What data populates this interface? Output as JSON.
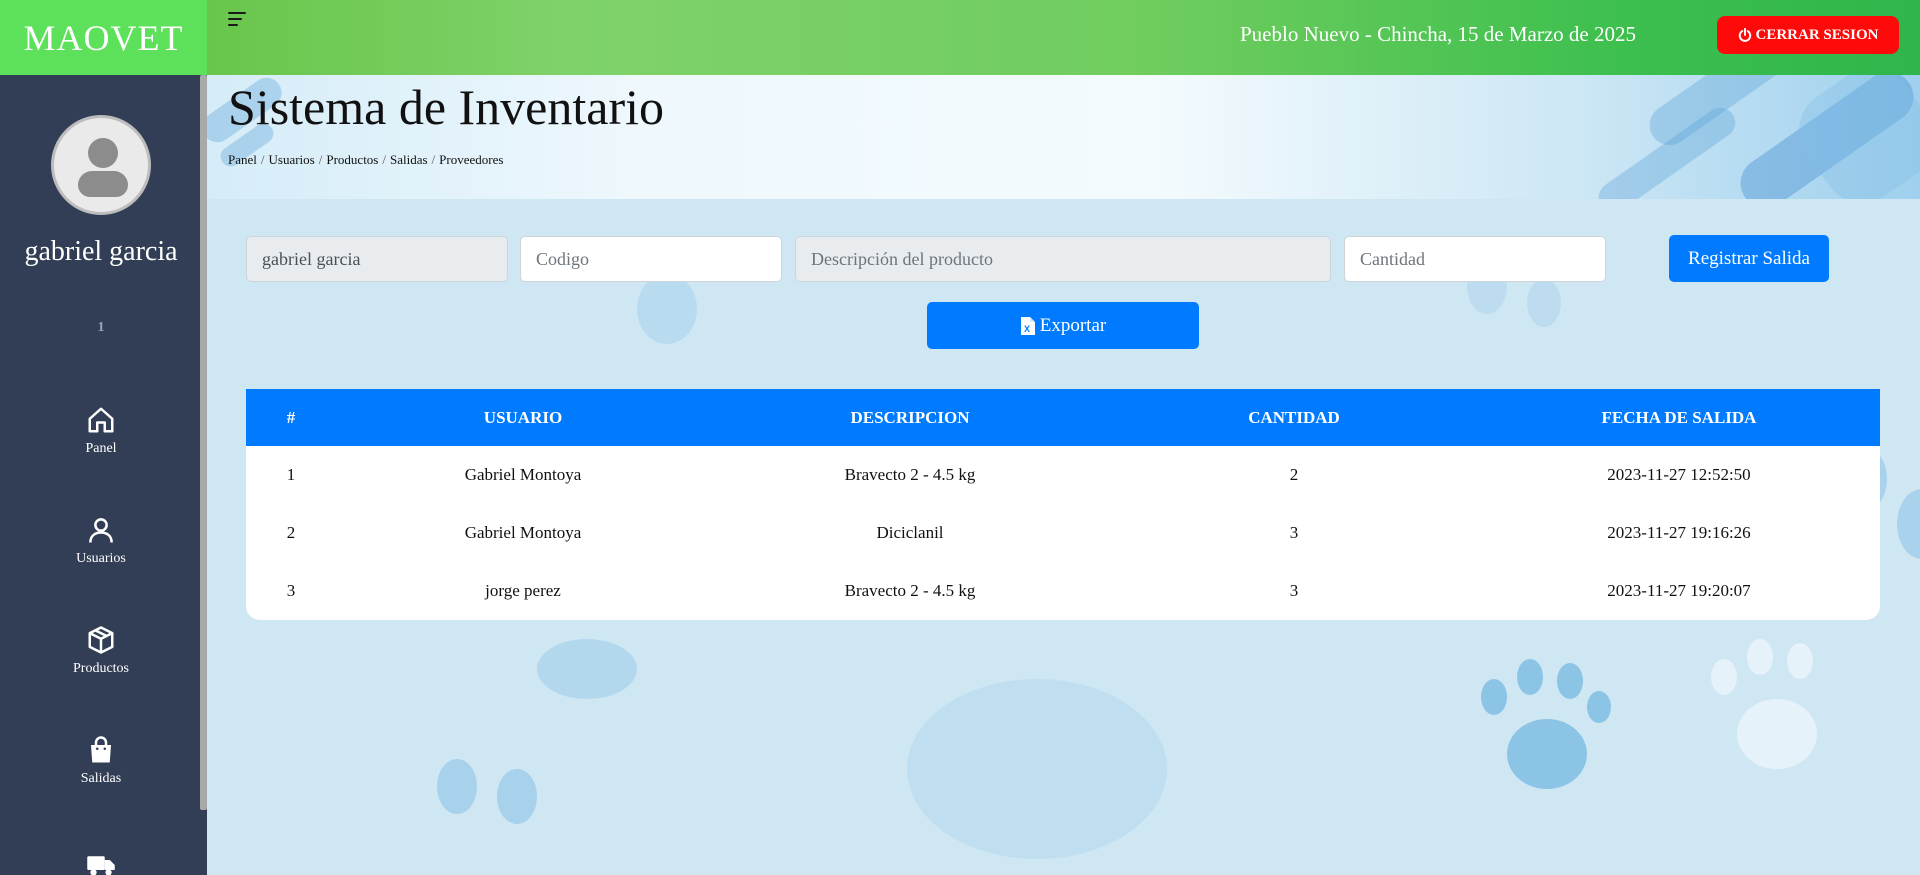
{
  "brand": "MAOVET",
  "header": {
    "date_text": "Pueblo Nuevo - Chincha, 15 de Marzo de 2025",
    "logout_label": "CERRAR SESION"
  },
  "sidebar": {
    "user_name": "gabriel garcia",
    "user_id": "1",
    "items": [
      {
        "label": "Panel",
        "icon": "home-icon"
      },
      {
        "label": "Usuarios",
        "icon": "user-icon"
      },
      {
        "label": "Productos",
        "icon": "box-icon"
      },
      {
        "label": "Salidas",
        "icon": "shopping-bag-icon"
      },
      {
        "label": "",
        "icon": "truck-icon"
      }
    ]
  },
  "page": {
    "title": "Sistema de Inventario",
    "breadcrumb": [
      "Panel",
      "Usuarios",
      "Productos",
      "Salidas",
      "Proveedores"
    ]
  },
  "form": {
    "user_value": "gabriel garcia",
    "code_placeholder": "Codigo",
    "description_placeholder": "Descripción del producto",
    "quantity_placeholder": "Cantidad",
    "register_label": "Registrar Salida",
    "export_label": "Exportar"
  },
  "table": {
    "headers": [
      "#",
      "USUARIO",
      "DESCRIPCION",
      "CANTIDAD",
      "FECHA DE SALIDA"
    ],
    "rows": [
      [
        "1",
        "Gabriel Montoya",
        "Bravecto 2 - 4.5 kg",
        "2",
        "2023-11-27 12:52:50"
      ],
      [
        "2",
        "Gabriel Montoya",
        "Diciclanil",
        "3",
        "2023-11-27 19:16:26"
      ],
      [
        "3",
        "jorge perez",
        "Bravecto 2 - 4.5 kg",
        "3",
        "2023-11-27 19:20:07"
      ]
    ]
  },
  "colors": {
    "brand_green": "#5de05a",
    "sidebar_bg": "#323e55",
    "primary_blue": "#007bff",
    "danger_red": "#ff0a0a"
  }
}
